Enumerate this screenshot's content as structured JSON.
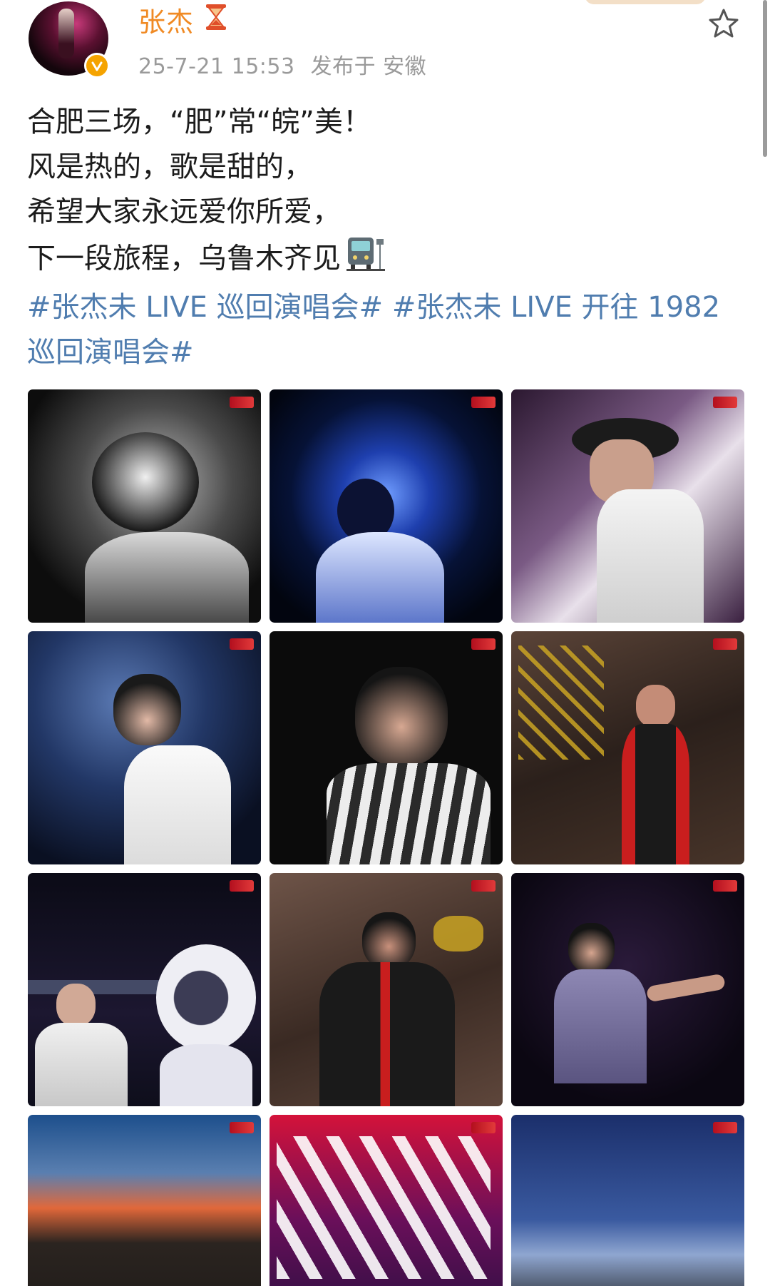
{
  "post": {
    "username": "张杰",
    "time": "25-7-21 15:53",
    "location": "发布于 安徽",
    "lines": [
      "合肥三场，“肥”常“皖”美！",
      "风是热的，歌是甜的，",
      "希望大家永远爱你所爱，",
      "下一段旅程，乌鲁木齐见"
    ],
    "topics_line1": "#张杰未 LIVE 巡回演唱会# #张杰未 LIVE 开往 1982",
    "topics_line2": "巡回演唱会#",
    "photos": [
      {
        "desc": "black-and-white portrait, head bowed, hands clasped"
      },
      {
        "desc": "blue-lit singer with microphone"
      },
      {
        "desc": "singer in black hat and white vest"
      },
      {
        "desc": "singer in white shirt with headset mic"
      },
      {
        "desc": "singer in striped shirt with glasses"
      },
      {
        "desc": "singer in red and black outfit with gold confetti"
      },
      {
        "desc": "singer beside astronaut mascot"
      },
      {
        "desc": "singer in black and red jacket"
      },
      {
        "desc": "singer in purple-lit sleeveless vest"
      },
      {
        "desc": "city sunset aerial view of stadium"
      },
      {
        "desc": "large white calligraphy on red stage"
      },
      {
        "desc": "stadium roof under dusk sky"
      }
    ]
  },
  "icons": {
    "verified": "verified-badge-icon",
    "hourglass": "hourglass-icon",
    "star": "star-icon",
    "train": "train-icon"
  },
  "colors": {
    "username": "#f08a24",
    "topic": "#507daf",
    "meta": "#9a9a9a",
    "badge": "#f5a300"
  }
}
